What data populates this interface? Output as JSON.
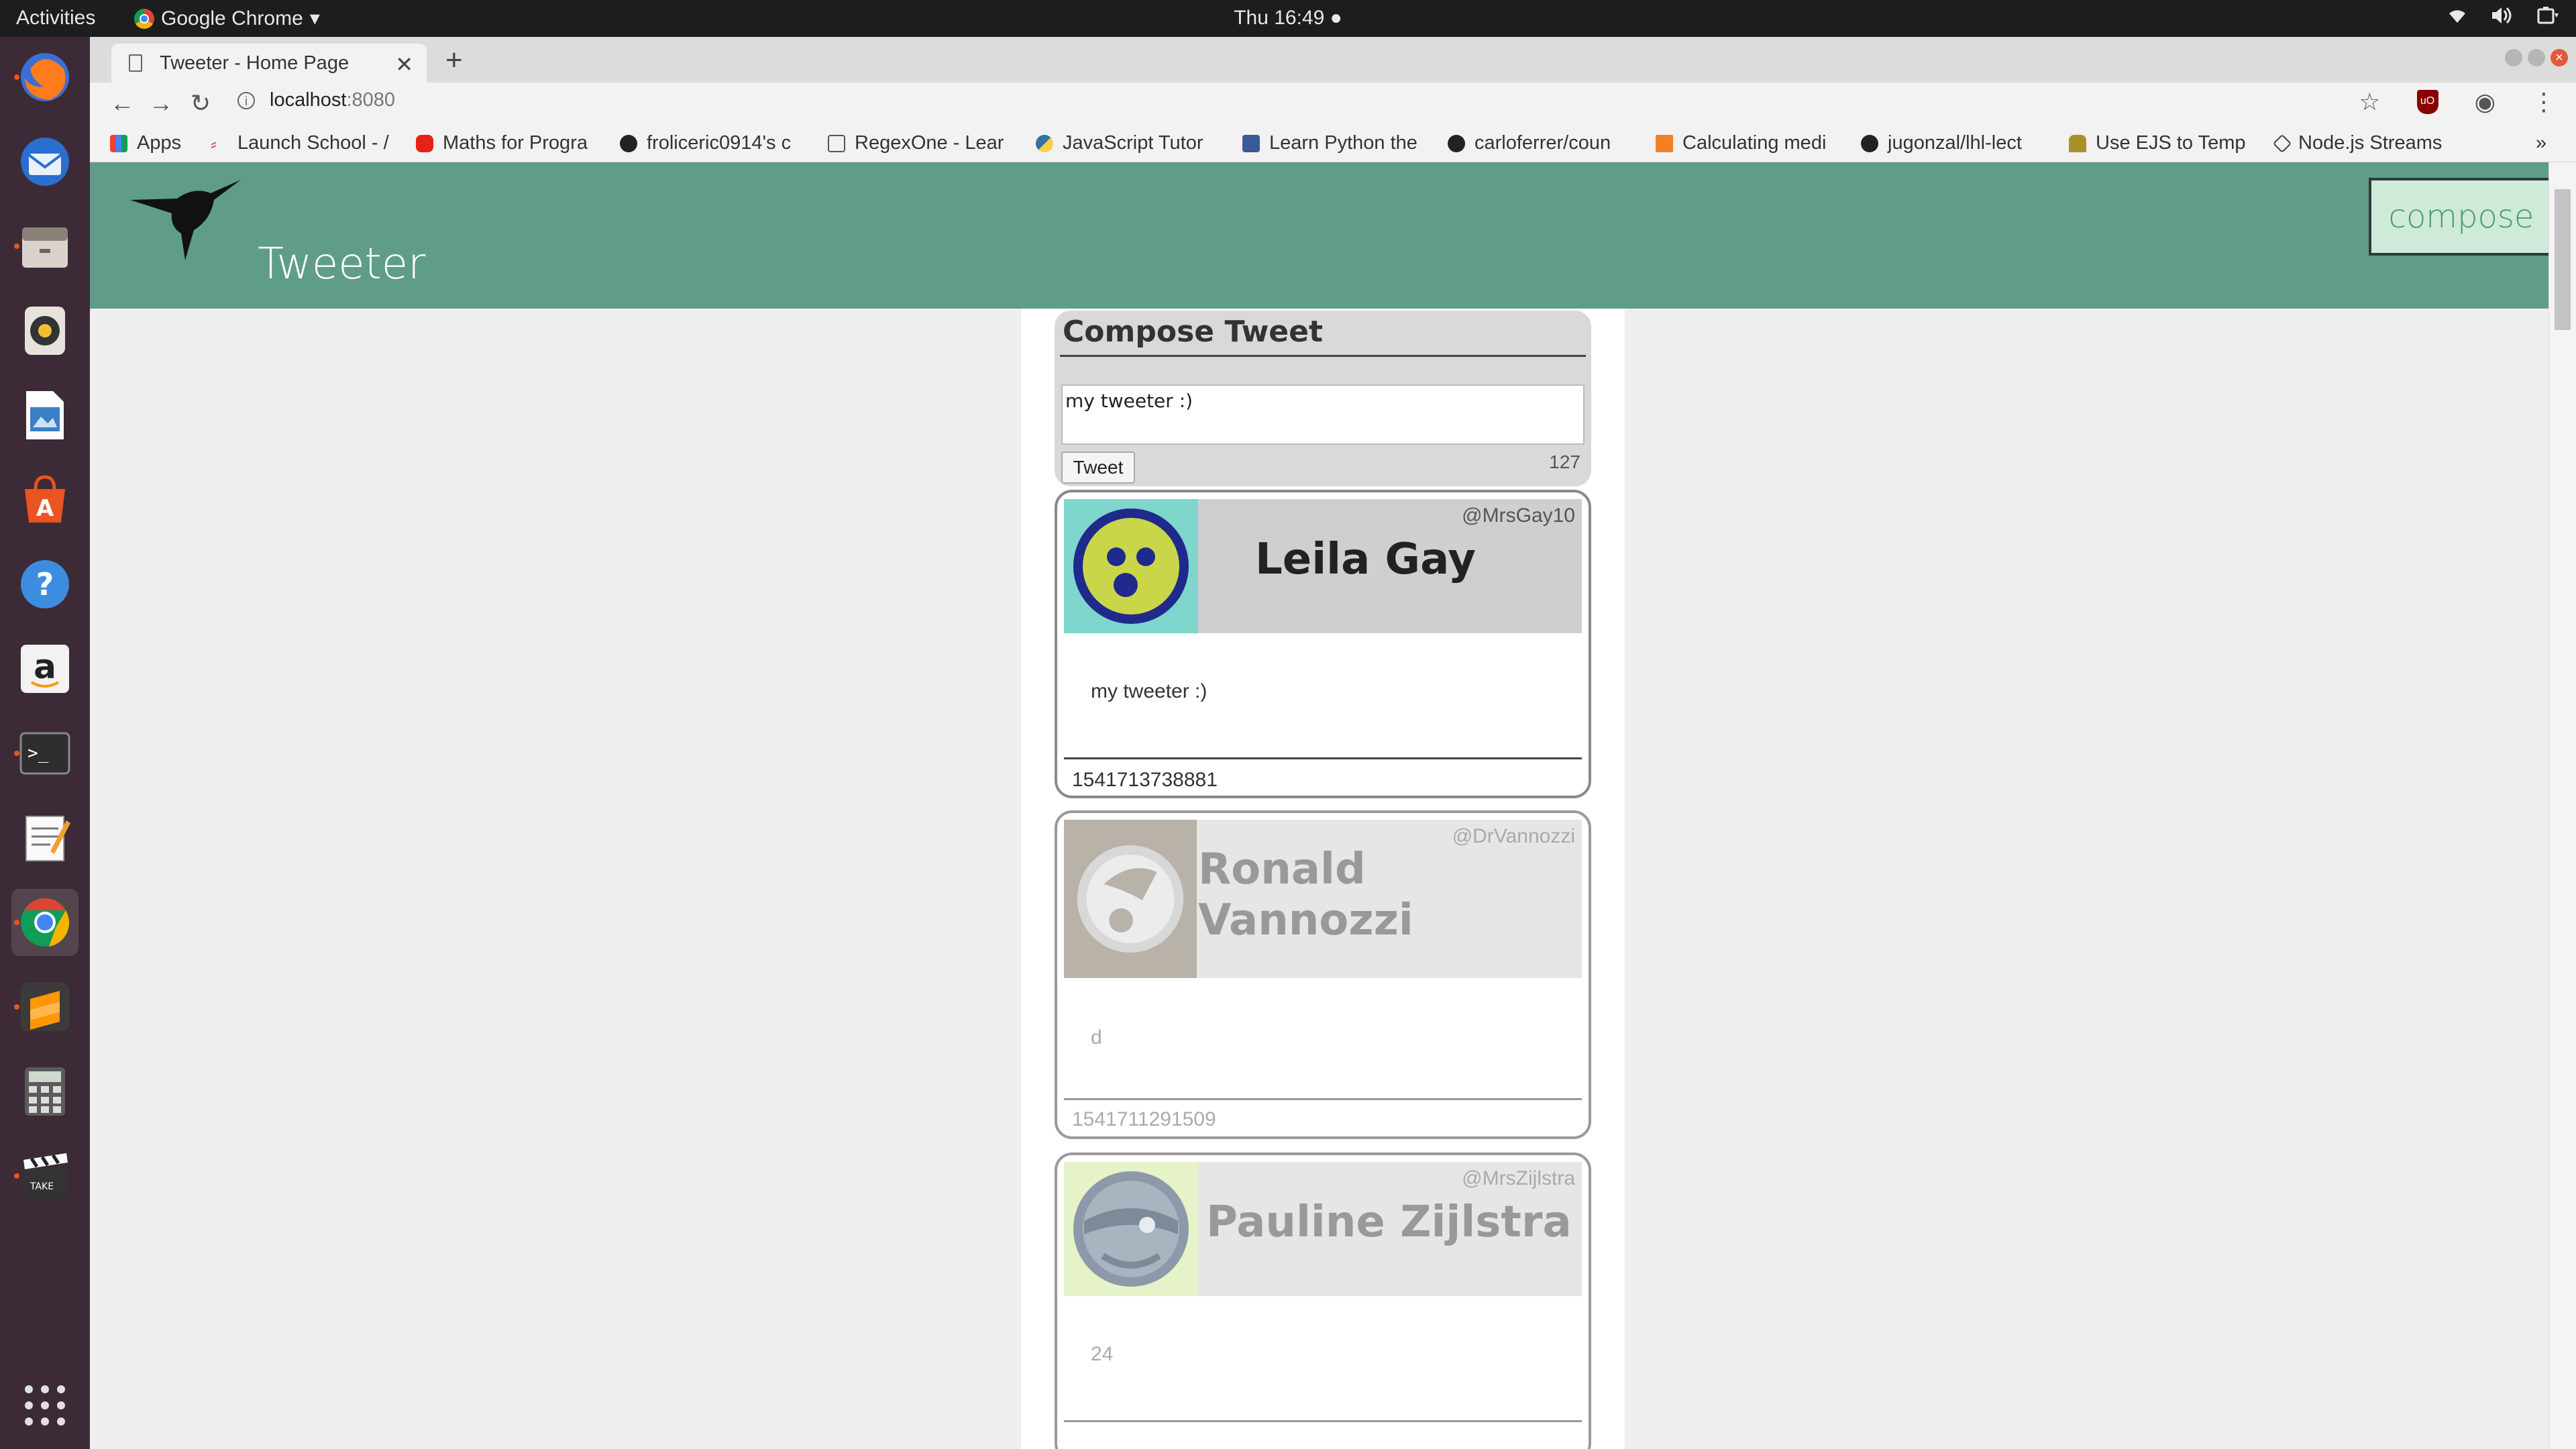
{
  "topbar": {
    "activities": "Activities",
    "app_name": "Google Chrome",
    "clock": "Thu 16:49"
  },
  "dock": {
    "items": [
      "firefox-icon",
      "thunderbird-icon",
      "files-icon",
      "rhythmbox-icon",
      "libreoffice-impress-icon",
      "software-center-icon",
      "help-icon",
      "amazon-icon",
      "terminal-icon",
      "text-editor-icon",
      "chrome-icon",
      "sublime-text-icon",
      "calculator-icon",
      "video-editor-icon",
      "show-applications-icon"
    ]
  },
  "browser": {
    "tab_title": "Tweeter - Home Page",
    "url_host": "localhost",
    "url_port": ":8080",
    "bookmarks": [
      {
        "label": "Apps",
        "icon": "apps-grid-icon",
        "color": "#e94235"
      },
      {
        "label": "Launch School - /",
        "icon": "launch-school-icon",
        "color": "#d9534f"
      },
      {
        "label": "Maths for Progra",
        "icon": "youtube-icon",
        "color": "#e62117"
      },
      {
        "label": "froliceric0914's c",
        "icon": "github-icon",
        "color": "#222222"
      },
      {
        "label": "RegexOne - Lear",
        "icon": "regex-icon",
        "color": "#555555"
      },
      {
        "label": "JavaScript Tutor",
        "icon": "python-tutor-icon",
        "color": "#3572a5"
      },
      {
        "label": "Learn Python the",
        "icon": "info-bookmark-icon",
        "color": "#3b5998"
      },
      {
        "label": "carloferrer/coun",
        "icon": "github-icon",
        "color": "#222222"
      },
      {
        "label": "Calculating medi",
        "icon": "bookmark-icon",
        "color": "#f48024"
      },
      {
        "label": "jugonzal/lhl-lect",
        "icon": "github-icon",
        "color": "#222222"
      },
      {
        "label": "Use EJS to Temp",
        "icon": "ejs-icon",
        "color": "#a8912a"
      },
      {
        "label": "Node.js Streams",
        "icon": "nodejs-icon",
        "color": "#444444"
      }
    ],
    "more": "»"
  },
  "app": {
    "brand": "Tweeter",
    "compose_label": "compose",
    "compose_title": "Compose Tweet",
    "textarea_value": "my tweeter :)",
    "tweet_button": "Tweet",
    "char_counter": "127"
  },
  "tweets": [
    {
      "name": "Leila Gay",
      "handle": "@MrsGay10",
      "text": "my tweeter :)",
      "timestamp": "1541713738881",
      "avatar_bg": "#7ed6cc",
      "avatar_fg": "#c9d64a",
      "avatar_ring": "#1f2a8c",
      "faded": false
    },
    {
      "name": "Ronald Vannozzi",
      "handle": "@DrVannozzi",
      "text": "d",
      "timestamp": "1541711291509",
      "avatar_bg": "#b9b2a8",
      "avatar_fg": "#e8e8e8",
      "avatar_ring": "#d8d8d8",
      "faded": true
    },
    {
      "name": "Pauline Zijlstra",
      "handle": "@MrsZijlstra",
      "text": "24",
      "timestamp": "",
      "avatar_bg": "#e6f2c8",
      "avatar_fg": "#9aa6b4",
      "avatar_ring": "#8d99a8",
      "faded": true
    }
  ]
}
